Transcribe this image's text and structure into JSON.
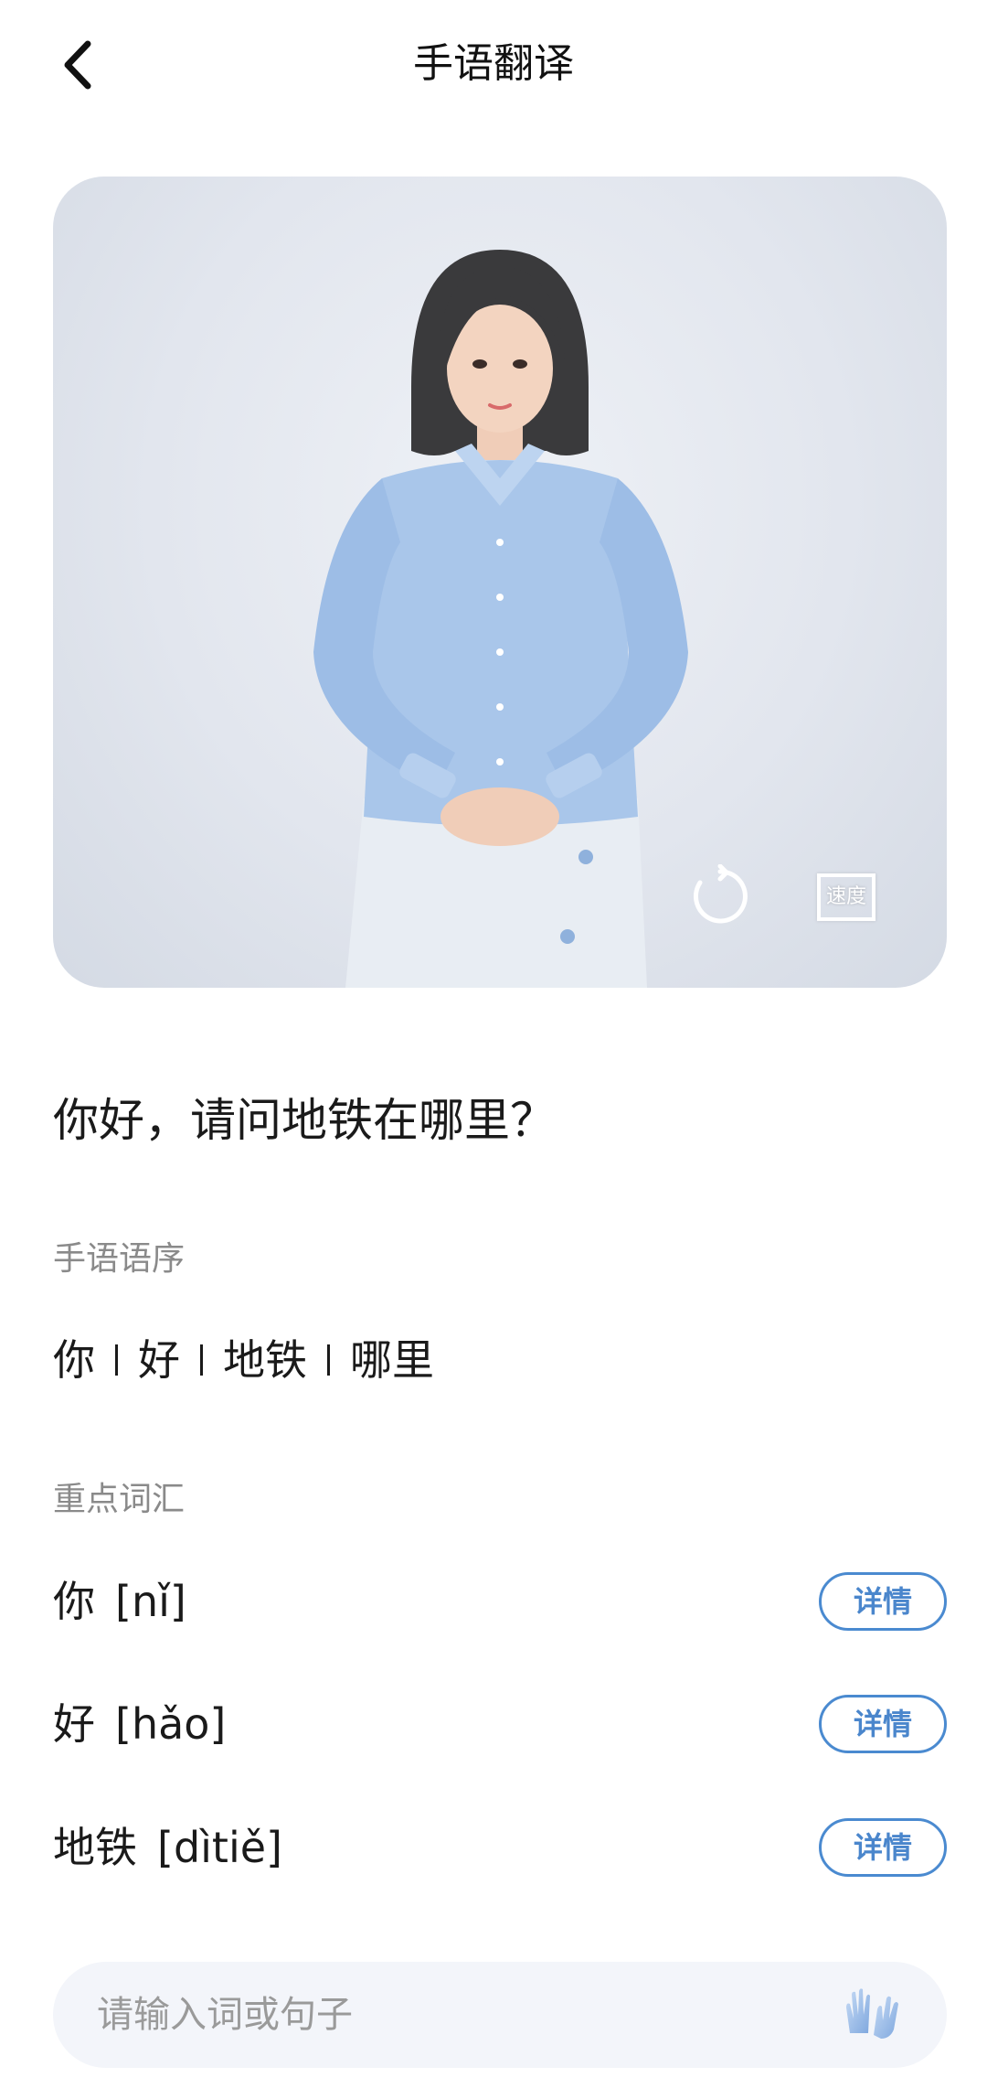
{
  "header": {
    "title": "手语翻译",
    "back_icon": "chevron-left-icon"
  },
  "avatar": {
    "replay_icon": "replay-icon",
    "speed_label": "速度",
    "colors": {
      "background": "#e2e6ee",
      "shirt": "#a9c6ea",
      "skirt": "#e8edf3"
    }
  },
  "sentence": "你好，请问地铁在哪里？",
  "sign_order": {
    "label": "手语语序",
    "words": [
      "你",
      "好",
      "地铁",
      "哪里"
    ]
  },
  "vocabulary": {
    "label": "重点词汇",
    "items": [
      {
        "word": "你",
        "pinyin": "[nǐ]",
        "button": "详情"
      },
      {
        "word": "好",
        "pinyin": "[hǎo]",
        "button": "详情"
      },
      {
        "word": "地铁",
        "pinyin": "[dìtiě]",
        "button": "详情"
      }
    ]
  },
  "input": {
    "placeholder": "请输入词或句子",
    "icon": "sign-language-hands-icon"
  },
  "accent_color": "#4a86cc"
}
